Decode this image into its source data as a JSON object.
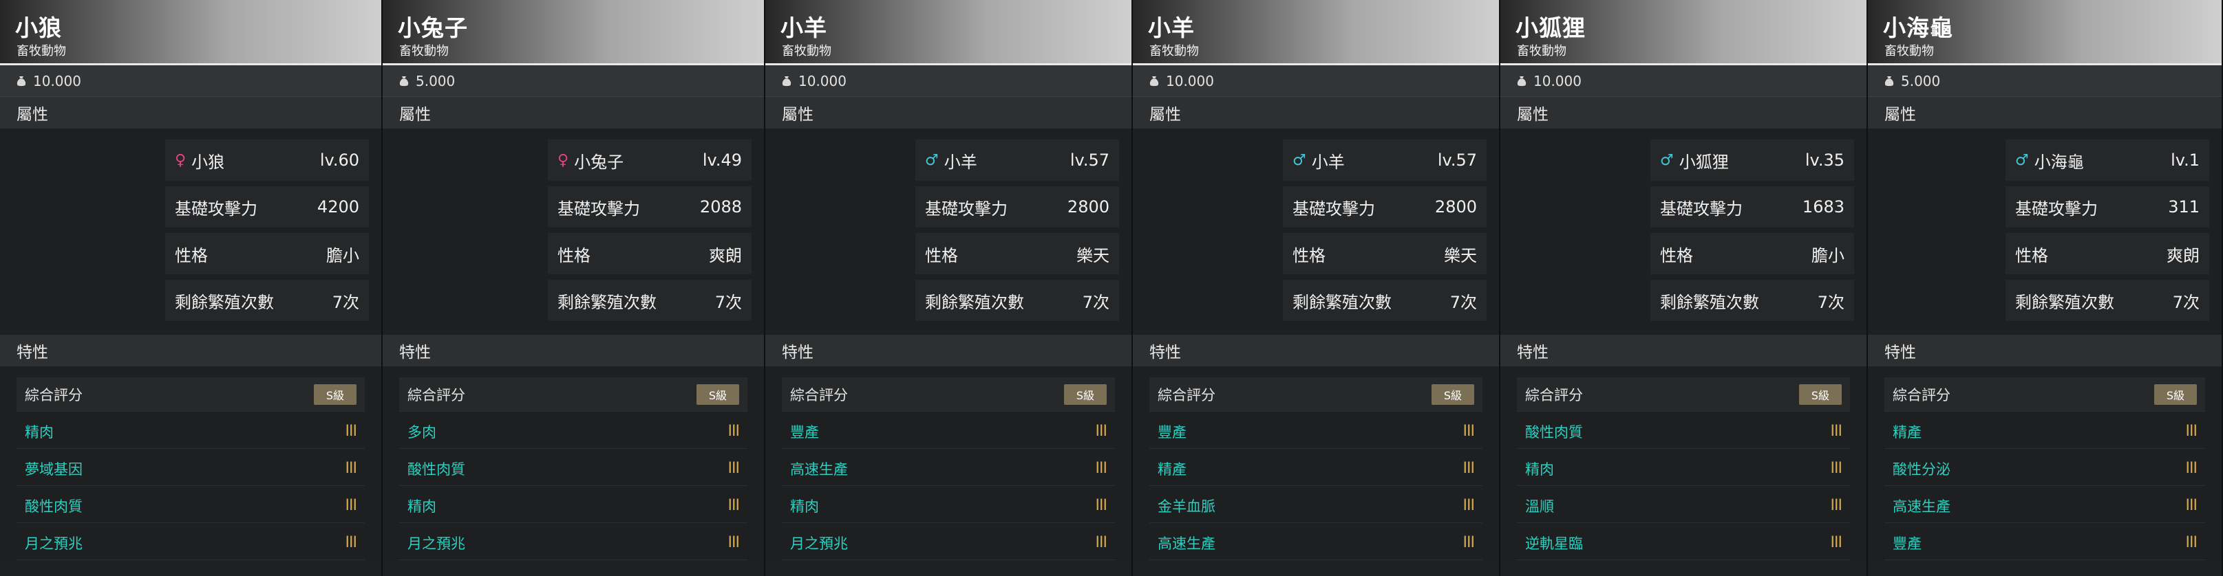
{
  "labels": {
    "category": "畜牧動物",
    "attributes": "屬性",
    "traits": "特性",
    "base_attack": "基礎攻擊力",
    "personality": "性格",
    "breeding_left": "剩餘繁殖次數",
    "overall_rating": "綜合評分"
  },
  "cards": [
    {
      "name": "小狼",
      "price": "10.000",
      "gender": "female",
      "gender_symbol": "♀",
      "level": "lv.60",
      "attack": "4200",
      "personality": "膽小",
      "breeding": "7次",
      "rank": "S級",
      "traits": [
        {
          "name": "精肉",
          "tier": "III"
        },
        {
          "name": "夢域基因",
          "tier": "III"
        },
        {
          "name": "酸性肉質",
          "tier": "III"
        },
        {
          "name": "月之預兆",
          "tier": "III"
        }
      ]
    },
    {
      "name": "小兔子",
      "price": "5.000",
      "gender": "female",
      "gender_symbol": "♀",
      "level": "lv.49",
      "attack": "2088",
      "personality": "爽朗",
      "breeding": "7次",
      "rank": "S級",
      "traits": [
        {
          "name": "多肉",
          "tier": "III"
        },
        {
          "name": "酸性肉質",
          "tier": "III"
        },
        {
          "name": "精肉",
          "tier": "III"
        },
        {
          "name": "月之預兆",
          "tier": "III"
        }
      ]
    },
    {
      "name": "小羊",
      "price": "10.000",
      "gender": "male",
      "gender_symbol": "♂",
      "level": "lv.57",
      "attack": "2800",
      "personality": "樂天",
      "breeding": "7次",
      "rank": "S級",
      "traits": [
        {
          "name": "豐產",
          "tier": "III"
        },
        {
          "name": "高速生產",
          "tier": "III"
        },
        {
          "name": "精肉",
          "tier": "III"
        },
        {
          "name": "月之預兆",
          "tier": "III"
        }
      ]
    },
    {
      "name": "小羊",
      "price": "10.000",
      "gender": "male",
      "gender_symbol": "♂",
      "level": "lv.57",
      "attack": "2800",
      "personality": "樂天",
      "breeding": "7次",
      "rank": "S級",
      "traits": [
        {
          "name": "豐產",
          "tier": "III"
        },
        {
          "name": "精產",
          "tier": "III"
        },
        {
          "name": "金羊血脈",
          "tier": "III"
        },
        {
          "name": "高速生產",
          "tier": "III"
        }
      ]
    },
    {
      "name": "小狐狸",
      "price": "10.000",
      "gender": "male",
      "gender_symbol": "♂",
      "level": "lv.35",
      "attack": "1683",
      "personality": "膽小",
      "breeding": "7次",
      "rank": "S級",
      "traits": [
        {
          "name": "酸性肉質",
          "tier": "III"
        },
        {
          "name": "精肉",
          "tier": "III"
        },
        {
          "name": "溫順",
          "tier": "III"
        },
        {
          "name": "逆軌星臨",
          "tier": "III"
        }
      ]
    },
    {
      "name": "小海龜",
      "price": "5.000",
      "gender": "male",
      "gender_symbol": "♂",
      "level": "lv.1",
      "attack": "311",
      "personality": "爽朗",
      "breeding": "7次",
      "rank": "S級",
      "traits": [
        {
          "name": "精產",
          "tier": "III"
        },
        {
          "name": "酸性分泌",
          "tier": "III"
        },
        {
          "name": "高速生產",
          "tier": "III"
        },
        {
          "name": "豐產",
          "tier": "III"
        }
      ]
    }
  ]
}
